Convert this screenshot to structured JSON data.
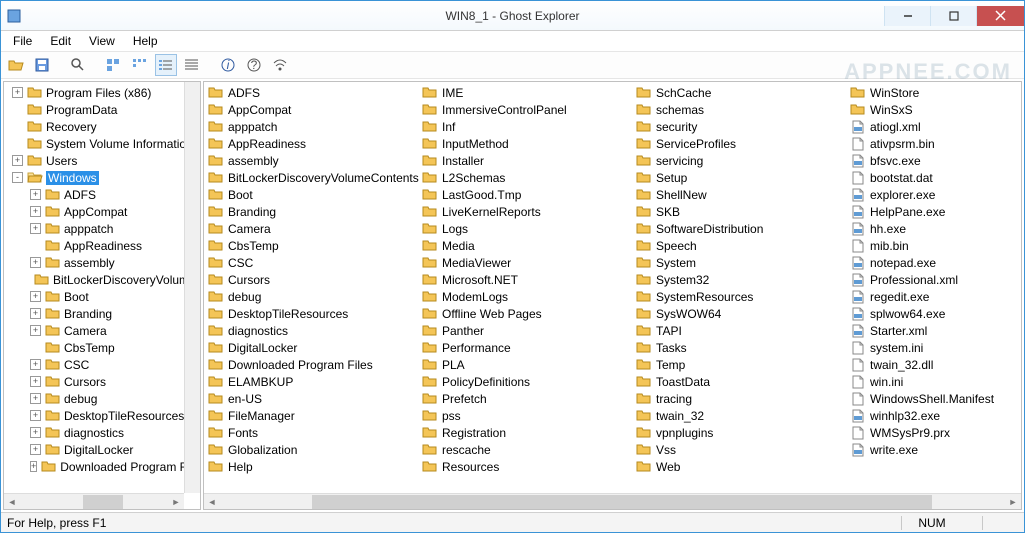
{
  "title": "WIN8_1 - Ghost Explorer",
  "watermark": "APPNEE.COM",
  "menu": [
    "File",
    "Edit",
    "View",
    "Help"
  ],
  "status": {
    "help": "For Help, press F1",
    "num": "NUM"
  },
  "winbtn": {
    "min": "Minimize",
    "max": "Maximize",
    "close": "Close"
  },
  "tree": [
    {
      "depth": 0,
      "exp": "+",
      "label": "Program Files (x86)"
    },
    {
      "depth": 0,
      "exp": "",
      "label": "ProgramData"
    },
    {
      "depth": 0,
      "exp": "",
      "label": "Recovery"
    },
    {
      "depth": 0,
      "exp": "",
      "label": "System Volume Information"
    },
    {
      "depth": 0,
      "exp": "+",
      "label": "Users"
    },
    {
      "depth": 0,
      "exp": "-",
      "label": "Windows",
      "selected": true,
      "open": true
    },
    {
      "depth": 1,
      "exp": "+",
      "label": "ADFS"
    },
    {
      "depth": 1,
      "exp": "+",
      "label": "AppCompat"
    },
    {
      "depth": 1,
      "exp": "+",
      "label": "apppatch"
    },
    {
      "depth": 1,
      "exp": "",
      "label": "AppReadiness"
    },
    {
      "depth": 1,
      "exp": "+",
      "label": "assembly"
    },
    {
      "depth": 1,
      "exp": "",
      "label": "BitLockerDiscoveryVolumeContents"
    },
    {
      "depth": 1,
      "exp": "+",
      "label": "Boot"
    },
    {
      "depth": 1,
      "exp": "+",
      "label": "Branding"
    },
    {
      "depth": 1,
      "exp": "+",
      "label": "Camera"
    },
    {
      "depth": 1,
      "exp": "",
      "label": "CbsTemp"
    },
    {
      "depth": 1,
      "exp": "+",
      "label": "CSC"
    },
    {
      "depth": 1,
      "exp": "+",
      "label": "Cursors"
    },
    {
      "depth": 1,
      "exp": "+",
      "label": "debug"
    },
    {
      "depth": 1,
      "exp": "+",
      "label": "DesktopTileResources"
    },
    {
      "depth": 1,
      "exp": "+",
      "label": "diagnostics"
    },
    {
      "depth": 1,
      "exp": "+",
      "label": "DigitalLocker"
    },
    {
      "depth": 1,
      "exp": "+",
      "label": "Downloaded Program Files"
    }
  ],
  "list": [
    {
      "t": "folder",
      "n": "ADFS"
    },
    {
      "t": "folder",
      "n": "AppCompat"
    },
    {
      "t": "folder",
      "n": "apppatch"
    },
    {
      "t": "folder",
      "n": "AppReadiness"
    },
    {
      "t": "folder",
      "n": "assembly"
    },
    {
      "t": "folder",
      "n": "BitLockerDiscoveryVolumeContents"
    },
    {
      "t": "folder",
      "n": "Boot"
    },
    {
      "t": "folder",
      "n": "Branding"
    },
    {
      "t": "folder",
      "n": "Camera"
    },
    {
      "t": "folder",
      "n": "CbsTemp"
    },
    {
      "t": "folder",
      "n": "CSC"
    },
    {
      "t": "folder",
      "n": "Cursors"
    },
    {
      "t": "folder",
      "n": "debug"
    },
    {
      "t": "folder",
      "n": "DesktopTileResources"
    },
    {
      "t": "folder",
      "n": "diagnostics"
    },
    {
      "t": "folder",
      "n": "DigitalLocker"
    },
    {
      "t": "folder",
      "n": "Downloaded Program Files"
    },
    {
      "t": "folder",
      "n": "ELAMBKUP"
    },
    {
      "t": "folder",
      "n": "en-US"
    },
    {
      "t": "folder",
      "n": "FileManager"
    },
    {
      "t": "folder",
      "n": "Fonts"
    },
    {
      "t": "folder",
      "n": "Globalization"
    },
    {
      "t": "folder",
      "n": "Help"
    },
    {
      "t": "folder",
      "n": "IME"
    },
    {
      "t": "folder",
      "n": "ImmersiveControlPanel"
    },
    {
      "t": "folder",
      "n": "Inf"
    },
    {
      "t": "folder",
      "n": "InputMethod"
    },
    {
      "t": "folder",
      "n": "Installer"
    },
    {
      "t": "folder",
      "n": "L2Schemas"
    },
    {
      "t": "folder",
      "n": "LastGood.Tmp"
    },
    {
      "t": "folder",
      "n": "LiveKernelReports"
    },
    {
      "t": "folder",
      "n": "Logs"
    },
    {
      "t": "folder",
      "n": "Media"
    },
    {
      "t": "folder",
      "n": "MediaViewer"
    },
    {
      "t": "folder",
      "n": "Microsoft.NET"
    },
    {
      "t": "folder",
      "n": "ModemLogs"
    },
    {
      "t": "folder",
      "n": "Offline Web Pages"
    },
    {
      "t": "folder",
      "n": "Panther"
    },
    {
      "t": "folder",
      "n": "Performance"
    },
    {
      "t": "folder",
      "n": "PLA"
    },
    {
      "t": "folder",
      "n": "PolicyDefinitions"
    },
    {
      "t": "folder",
      "n": "Prefetch"
    },
    {
      "t": "folder",
      "n": "pss"
    },
    {
      "t": "folder",
      "n": "Registration"
    },
    {
      "t": "folder",
      "n": "rescache"
    },
    {
      "t": "folder",
      "n": "Resources"
    },
    {
      "t": "folder",
      "n": "SchCache"
    },
    {
      "t": "folder",
      "n": "schemas"
    },
    {
      "t": "folder",
      "n": "security"
    },
    {
      "t": "folder",
      "n": "ServiceProfiles"
    },
    {
      "t": "folder",
      "n": "servicing"
    },
    {
      "t": "folder",
      "n": "Setup"
    },
    {
      "t": "folder",
      "n": "ShellNew"
    },
    {
      "t": "folder",
      "n": "SKB"
    },
    {
      "t": "folder",
      "n": "SoftwareDistribution"
    },
    {
      "t": "folder",
      "n": "Speech"
    },
    {
      "t": "folder",
      "n": "System"
    },
    {
      "t": "folder",
      "n": "System32"
    },
    {
      "t": "folder",
      "n": "SystemResources"
    },
    {
      "t": "folder",
      "n": "SysWOW64"
    },
    {
      "t": "folder",
      "n": "TAPI"
    },
    {
      "t": "folder",
      "n": "Tasks"
    },
    {
      "t": "folder",
      "n": "Temp"
    },
    {
      "t": "folder",
      "n": "ToastData"
    },
    {
      "t": "folder",
      "n": "tracing"
    },
    {
      "t": "folder",
      "n": "twain_32"
    },
    {
      "t": "folder",
      "n": "vpnplugins"
    },
    {
      "t": "folder",
      "n": "Vss"
    },
    {
      "t": "folder",
      "n": "Web"
    },
    {
      "t": "folder",
      "n": "WinStore"
    },
    {
      "t": "folder",
      "n": "WinSxS"
    },
    {
      "t": "xml",
      "n": "atiogl.xml"
    },
    {
      "t": "bin",
      "n": "ativpsrm.bin"
    },
    {
      "t": "exe",
      "n": "bfsvc.exe"
    },
    {
      "t": "dat",
      "n": "bootstat.dat"
    },
    {
      "t": "exe",
      "n": "explorer.exe"
    },
    {
      "t": "exe",
      "n": "HelpPane.exe"
    },
    {
      "t": "exe",
      "n": "hh.exe"
    },
    {
      "t": "bin",
      "n": "mib.bin"
    },
    {
      "t": "exe",
      "n": "notepad.exe"
    },
    {
      "t": "xml",
      "n": "Professional.xml"
    },
    {
      "t": "exe",
      "n": "regedit.exe"
    },
    {
      "t": "exe",
      "n": "splwow64.exe"
    },
    {
      "t": "xml",
      "n": "Starter.xml"
    },
    {
      "t": "ini",
      "n": "system.ini"
    },
    {
      "t": "dll",
      "n": "twain_32.dll"
    },
    {
      "t": "ini",
      "n": "win.ini"
    },
    {
      "t": "file",
      "n": "WindowsShell.Manifest"
    },
    {
      "t": "exe",
      "n": "winhlp32.exe"
    },
    {
      "t": "file",
      "n": "WMSysPr9.prx"
    },
    {
      "t": "exe",
      "n": "write.exe"
    }
  ]
}
